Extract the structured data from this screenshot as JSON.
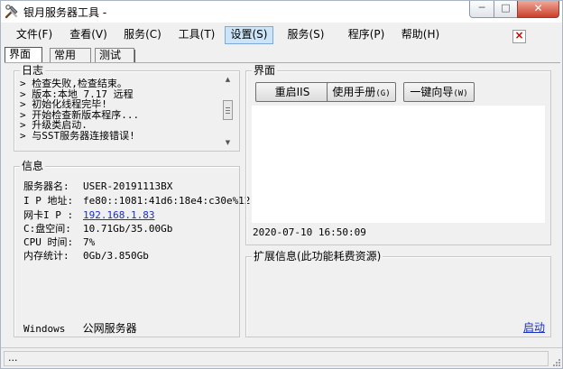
{
  "window": {
    "title": "银月服务器工具 -"
  },
  "caption_buttons": {
    "minimize": "─",
    "maximize": "□",
    "close": "✕"
  },
  "menu": [
    {
      "label": "文件(F)"
    },
    {
      "label": "查看(V)"
    },
    {
      "label": "服务(C)"
    },
    {
      "label": "工具(T)"
    },
    {
      "label": "设置(S)",
      "active": true
    },
    {
      "label": "服务(S)"
    },
    {
      "label": "程序(P)"
    },
    {
      "label": "帮助(H)"
    }
  ],
  "menu_close_glyph": "×",
  "tabs": [
    {
      "label": "界面",
      "selected": true
    },
    {
      "label": "常用"
    },
    {
      "label": "测试"
    }
  ],
  "log": {
    "title": "日志",
    "lines": [
      "> 检查失败,检查结束。",
      "> 版本:本地 7.17 远程",
      "> 初始化线程完毕!",
      "> 开始检查新版本程序...",
      "> 升级类启动.",
      "> 与SST服务器连接错误!"
    ]
  },
  "info": {
    "title": "信息",
    "rows": [
      {
        "label": "服务器名:",
        "value": "USER-20191113BX"
      },
      {
        "label": "I P 地址:",
        "value": "fe80::1081:41d6:18e4:c30e%12"
      },
      {
        "label": "网卡I P :",
        "value": "192.168.1.83",
        "link": true
      },
      {
        "label": "C:盘空间:",
        "value": "10.71Gb/35.00Gb"
      },
      {
        "label": "CPU 时间:",
        "value": "7%"
      },
      {
        "label": "内存统计:",
        "value": "0Gb/3.850Gb"
      }
    ],
    "footer_os": "Windows",
    "footer_type": "公网服务器"
  },
  "ui_panel": {
    "title": "界面",
    "buttons": [
      {
        "label": "重启IIS",
        "hotkey": ""
      },
      {
        "label": "使用手册",
        "hotkey": "(G)"
      },
      {
        "label": "一键向导",
        "hotkey": "(W)"
      }
    ],
    "datetime": "2020-07-10 16:50:09"
  },
  "ext_panel": {
    "title": "扩展信息(此功能耗费资源)",
    "start_link": "启动"
  },
  "status": {
    "text": "..."
  },
  "colors": {
    "link": "#1a2fc4",
    "menu_active_bg": "#cce4f7",
    "close_button": "#c8402c"
  }
}
